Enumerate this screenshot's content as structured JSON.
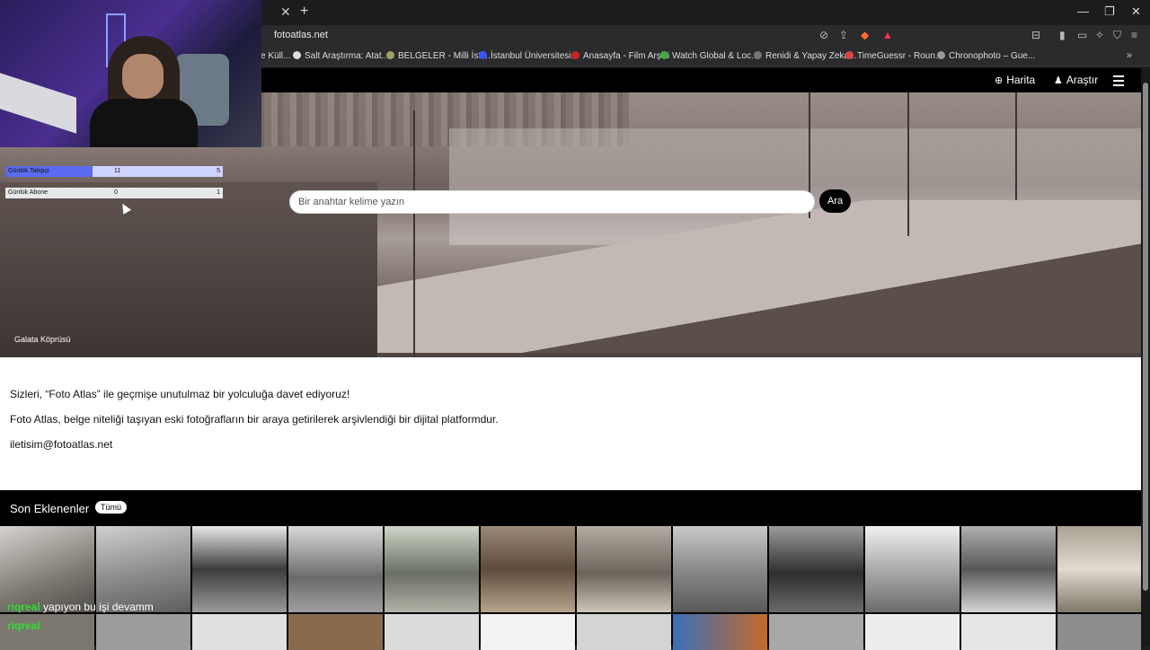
{
  "browser": {
    "url": "fotoatlas.net",
    "tab_close": "✕",
    "new_tab": "+",
    "bookmarks": [
      {
        "label": "e Küll...",
        "color": "#ff6600"
      },
      {
        "label": "Salt Araştırma: Atat...",
        "color": "#dddddd"
      },
      {
        "label": "BELGELER - Milli İsti...",
        "color": "#a0a060"
      },
      {
        "label": "İstanbul Üniversitesi...",
        "color": "#3355ff"
      },
      {
        "label": "Anasayfa - Film Arşivi",
        "color": "#cc2222"
      },
      {
        "label": "Watch Global & Loc...",
        "color": "#44aa44"
      },
      {
        "label": "Renidi & Yapay Zeka...",
        "color": "#777777"
      },
      {
        "label": "TimeGuessr - Roun...",
        "color": "#dd4444"
      },
      {
        "label": "Chronophoto – Gue...",
        "color": "#999999"
      }
    ]
  },
  "site": {
    "nav": {
      "map": "Harita",
      "research": "Araştır"
    },
    "search": {
      "placeholder": "Bir anahtar kelime yazın",
      "button": "Ara"
    },
    "hero_caption": "Galata Köprüsü",
    "intro": {
      "line1": "Sizleri, “Foto Atlas” ile geçmişe unutulmaz bir yolculuğa davet ediyoruz!",
      "line2": "Foto Atlas, belge niteliği taşıyan eski fotoğrafların bir araya getirilerek arşivlendiği bir dijital platformdur.",
      "email": "iletisim@fotoatlas.net"
    },
    "recent": {
      "title": "Son Eklenenler",
      "all_label": "Tümü"
    }
  },
  "overlay": {
    "stats": [
      {
        "label": "Günlük Takipçi",
        "v1": "11",
        "v2": "5"
      },
      {
        "label": "Günlük Abone",
        "v1": "0",
        "v2": "1"
      }
    ],
    "chat": {
      "user": "riqreal",
      "message": "yapıyon bu işi devamm",
      "user2": "riqreal"
    }
  }
}
